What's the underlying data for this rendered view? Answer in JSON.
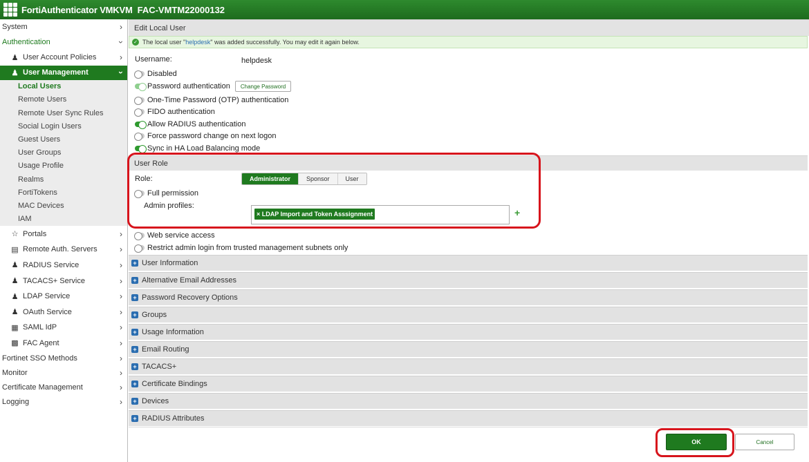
{
  "header": {
    "product": "FortiAuthenticator VMKVM",
    "serial": "FAC-VMTM22000132"
  },
  "sidebar": {
    "system": "System",
    "authentication": "Authentication",
    "user_account_policies": "User Account Policies",
    "user_management": "User Management",
    "leaves": [
      "Local Users",
      "Remote Users",
      "Remote User Sync Rules",
      "Social Login Users",
      "Guest Users",
      "User Groups",
      "Usage Profile",
      "Realms",
      "FortiTokens",
      "MAC Devices",
      "IAM"
    ],
    "subs": [
      "Portals",
      "Remote Auth. Servers",
      "RADIUS Service",
      "TACACS+ Service",
      "LDAP Service",
      "OAuth Service",
      "SAML IdP",
      "FAC Agent"
    ],
    "tops": [
      "Fortinet SSO Methods",
      "Monitor",
      "Certificate Management",
      "Logging"
    ]
  },
  "page": {
    "title": "Edit Local User",
    "notice_pre": "The local user \"",
    "notice_user": "helpdesk",
    "notice_post": "\" was added successfully. You may edit it again below.",
    "username_label": "Username:",
    "username_value": "helpdesk",
    "options": {
      "disabled": "Disabled",
      "password_auth": "Password authentication",
      "change_password": "Change Password",
      "otp": "One-Time Password (OTP) authentication",
      "fido": "FIDO authentication",
      "radius": "Allow RADIUS authentication",
      "force_pw": "Force password change on next logon",
      "sync_ha": "Sync in HA Load Balancing mode"
    },
    "user_role": {
      "title": "User Role",
      "role_label": "Role:",
      "roles": [
        "Administrator",
        "Sponsor",
        "User"
      ],
      "selected_role": "Administrator",
      "full_permission": "Full permission",
      "admin_profiles_label": "Admin profiles:",
      "admin_profile_chip": "LDAP Import and Token Asssignment"
    },
    "web_service": "Web service access",
    "restrict_admin": "Restrict admin login from trusted management subnets only",
    "sections": [
      "User Information",
      "Alternative Email Addresses",
      "Password Recovery Options",
      "Groups",
      "Usage Information",
      "Email Routing",
      "TACACS+",
      "Certificate Bindings",
      "Devices",
      "RADIUS Attributes"
    ],
    "ok": "OK",
    "cancel": "Cancel"
  },
  "colors": {
    "brand_green": "#1f7a1f",
    "highlight_red": "#d7141c",
    "section_icon_blue": "#2a6db0"
  }
}
